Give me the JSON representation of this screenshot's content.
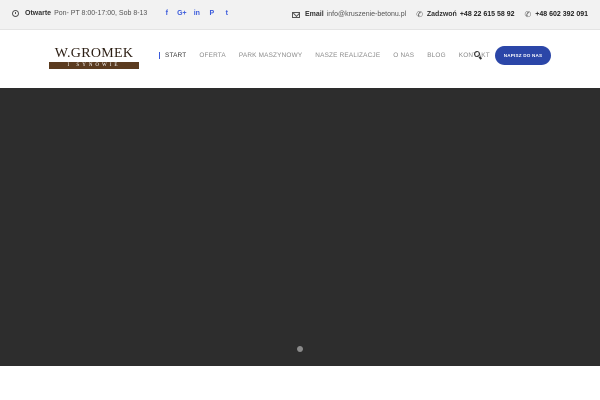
{
  "topbar": {
    "hours_label": "Otwarte",
    "hours_value": "Pon- PT 8:00-17:00, Sob 8-13",
    "social": [
      "f",
      "G+",
      "in",
      "P",
      "t"
    ],
    "email_label": "Email",
    "email_value": "info@kruszenie-betonu.pl",
    "call_label": "Zadzwoń",
    "phone1": "+48 22 615 58 92",
    "phone2": "+48 602 392 091"
  },
  "logo": {
    "top": "W.GROMEK",
    "bottom": "I SYNOWIE"
  },
  "nav": [
    "Start",
    "Oferta",
    "Park maszynowy",
    "Nasze realizacje",
    "O nas",
    "Blog",
    "Kontakt"
  ],
  "cta": "Napisz do nas"
}
